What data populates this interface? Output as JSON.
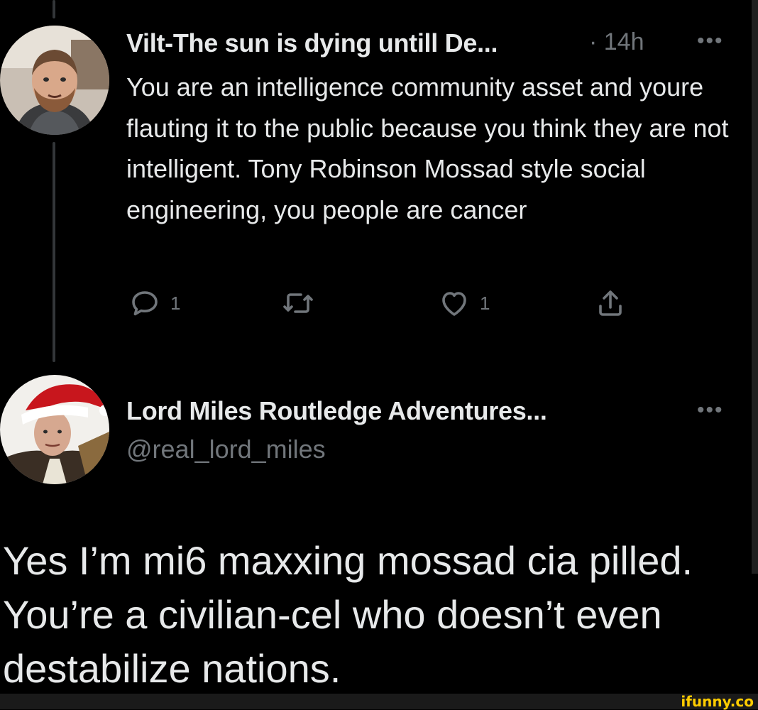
{
  "tweet1": {
    "author_name": "Vilt-The sun is dying untill De...",
    "time": "· 14h",
    "more": "•••",
    "text": "You are an intelligence community asset and youre flauting it to the public because you think they are not intelligent. Tony Robinson Mossad style social engineering, you people are cancer",
    "actions": {
      "reply_icon": "reply-icon",
      "reply_count": "1",
      "retweet_icon": "retweet-icon",
      "retweet_count": "",
      "like_icon": "heart-icon",
      "like_count": "1",
      "share_icon": "share-icon"
    }
  },
  "tweet2": {
    "author_name": "Lord Miles Routledge Adventures...",
    "handle": "@real_lord_miles",
    "more": "•••",
    "text": "Yes I’m mi6 maxxing mossad cia pilled. You’re a civilian-cel who doesn’t even destabilize nations."
  },
  "watermark": "ifunny.co",
  "colors": {
    "background": "#000000",
    "primary_text": "#e7e9ea",
    "secondary_text": "#71767b",
    "thread_line": "#333639",
    "watermark": "#ffcc00"
  }
}
